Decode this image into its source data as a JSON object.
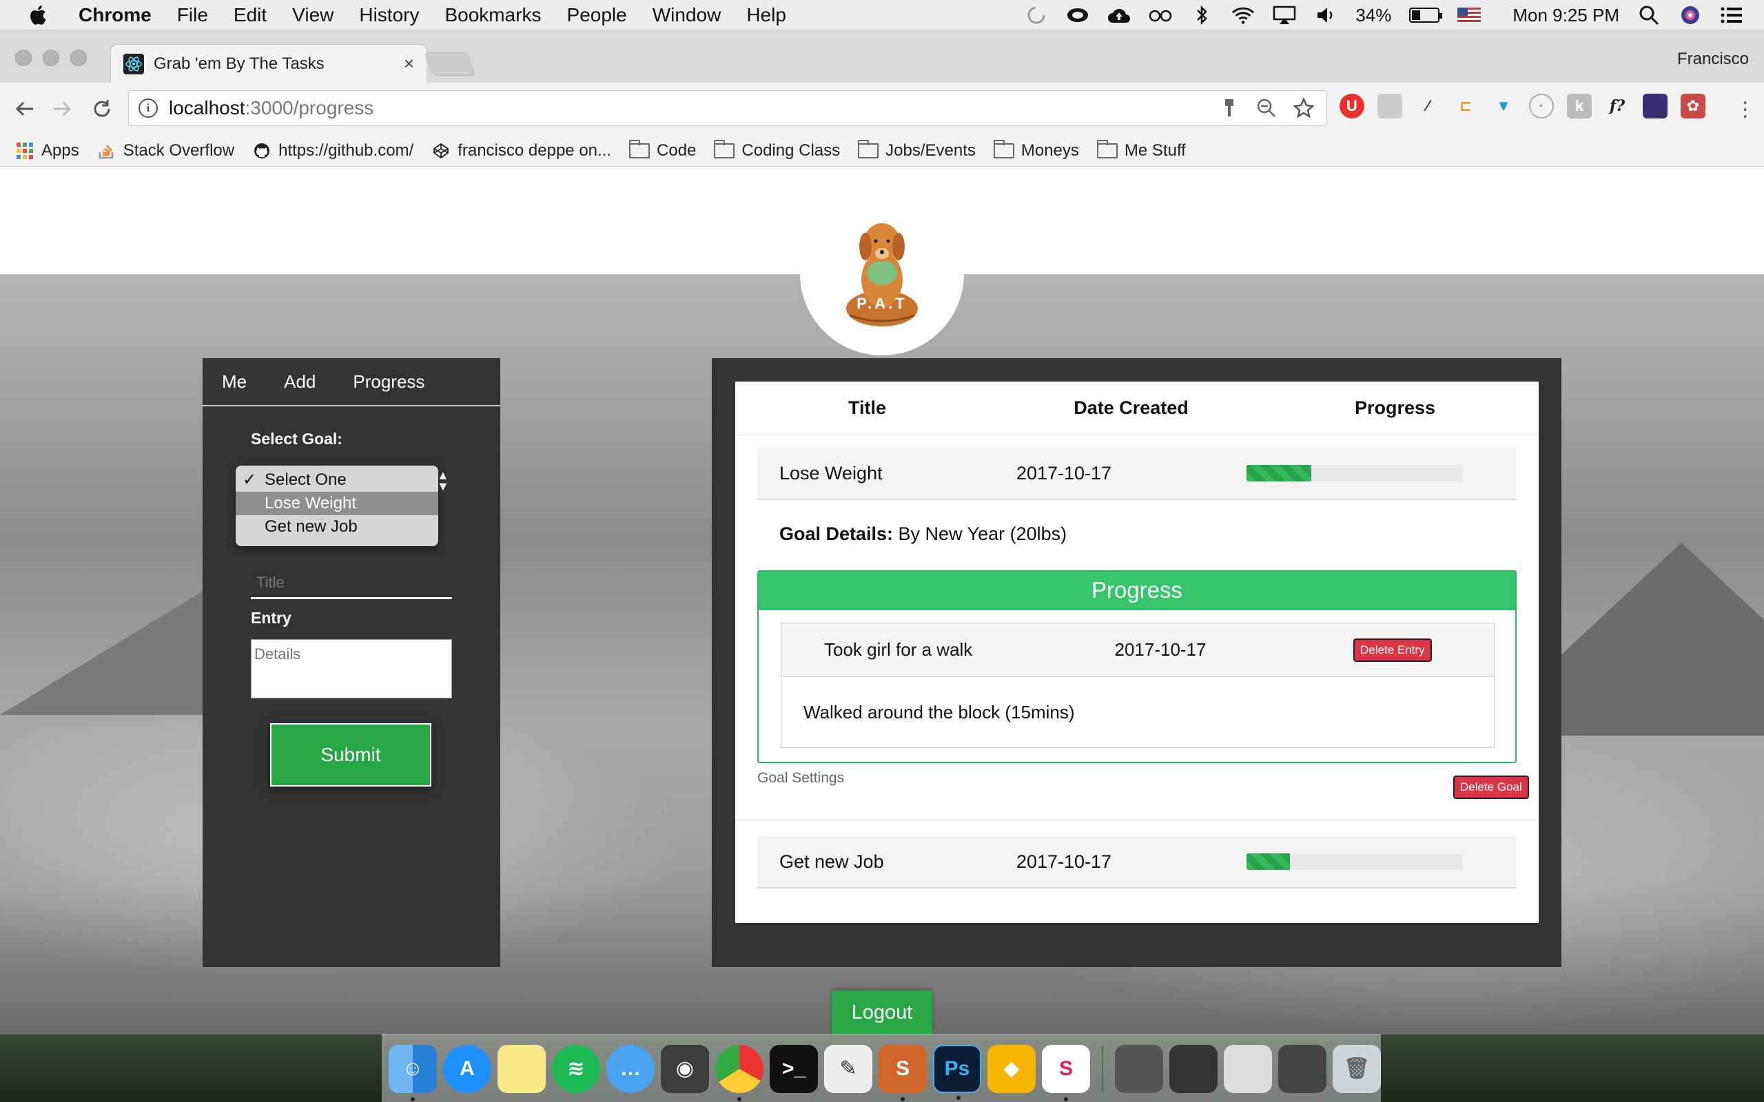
{
  "menubar": {
    "app_name": "Chrome",
    "items": [
      "File",
      "Edit",
      "View",
      "History",
      "Bookmarks",
      "People",
      "Window",
      "Help"
    ],
    "battery_percent": "34%",
    "clock": "Mon 9:25 PM"
  },
  "browser": {
    "tab_title": "Grab 'em By The Tasks",
    "tab_close": "×",
    "profile_name": "Francisco",
    "url_host": "localhost",
    "url_rest": ":3000/progress"
  },
  "bookmarks": [
    {
      "label": "Apps",
      "icon": "apps-grid-icon"
    },
    {
      "label": "Stack Overflow",
      "icon": "stackoverflow-icon"
    },
    {
      "label": "https://github.com/",
      "icon": "github-icon"
    },
    {
      "label": "francisco deppe on...",
      "icon": "codepen-icon"
    },
    {
      "label": "Code",
      "icon": "folder-icon"
    },
    {
      "label": "Coding Class",
      "icon": "folder-icon"
    },
    {
      "label": "Jobs/Events",
      "icon": "folder-icon"
    },
    {
      "label": "Moneys",
      "icon": "folder-icon"
    },
    {
      "label": "Me Stuff",
      "icon": "folder-icon"
    }
  ],
  "logo": {
    "text": "P.A.T"
  },
  "sidebar": {
    "nav": [
      "Me",
      "Add",
      "Progress"
    ],
    "select_goal_label": "Select Goal:",
    "select_options": [
      {
        "label": "Select One",
        "checked": true,
        "highlighted": false
      },
      {
        "label": "Lose Weight",
        "checked": false,
        "highlighted": true
      },
      {
        "label": "Get new Job",
        "checked": false,
        "highlighted": false
      }
    ],
    "title_placeholder": "Title",
    "entry_label": "Entry",
    "details_placeholder": "Details",
    "submit_label": "Submit"
  },
  "table": {
    "headers": [
      "Title",
      "Date Created",
      "Progress"
    ],
    "goals": [
      {
        "title": "Lose Weight",
        "date": "2017-10-17",
        "progress_fraction": 0.3
      },
      {
        "title": "Get new Job",
        "date": "2017-10-17",
        "progress_fraction": 0.2
      }
    ],
    "goal_details_label": "Goal Details:",
    "goal_details_text": " By New Year (20lbs)",
    "progress_header": "Progress",
    "entry": {
      "title": "Took girl for a walk",
      "date": "2017-10-17",
      "delete_label": "Delete Entry",
      "details": "Walked around the block (15mins)"
    },
    "goal_settings_label": "Goal Settings",
    "delete_goal_label": "Delete Goal"
  },
  "logout_label": "Logout",
  "colors": {
    "accent_green": "#28a745",
    "progress_green": "#36c56a",
    "danger_red": "#dc3545",
    "panel_dark": "#333333"
  }
}
